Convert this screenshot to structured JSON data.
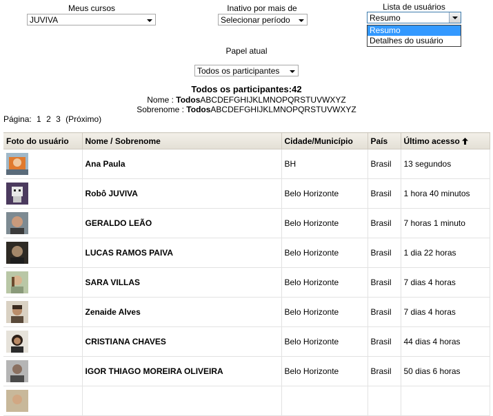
{
  "filters": {
    "courses": {
      "label": "Meus cursos",
      "value": "JUVIVA"
    },
    "inactive": {
      "label": "Inativo por mais de",
      "value": "Selecionar período"
    },
    "list": {
      "label": "Lista de usuários",
      "value": "Resumo",
      "options": [
        "Resumo",
        "Detalhes do usuário"
      ]
    },
    "role": {
      "label": "Papel atual",
      "value": "Todos os participantes"
    }
  },
  "summary": {
    "title": "Todos os participantes:42",
    "name_label": "Nome :",
    "surname_label": "Sobrenome :",
    "all": "Todos",
    "letters": "ABCDEFGHIJKLMNOPQRSTUVWXYZ"
  },
  "pager": {
    "label": "Página:",
    "pages": [
      "1",
      "2",
      "3"
    ],
    "next": "(Próximo)"
  },
  "table": {
    "headers": [
      "Foto do usuário",
      "Nome / Sobrenome",
      "Cidade/Município",
      "País",
      "Último acesso"
    ],
    "rows": [
      {
        "name": "Ana Paula",
        "city": "BH",
        "country": "Brasil",
        "last": "13 segundos"
      },
      {
        "name": "Robô JUVIVA",
        "city": "Belo Horizonte",
        "country": "Brasil",
        "last": "1 hora 40 minutos"
      },
      {
        "name": "GERALDO LEÃO",
        "city": "Belo Horizonte",
        "country": "Brasil",
        "last": "7 horas 1 minuto"
      },
      {
        "name": "LUCAS RAMOS PAIVA",
        "city": "Belo Horizonte",
        "country": "Brasil",
        "last": "1 dia 22 horas"
      },
      {
        "name": "SARA VILLAS",
        "city": "Belo Horizonte",
        "country": "Brasil",
        "last": "7 dias 4 horas"
      },
      {
        "name": "Zenaide Alves",
        "city": "Belo Horizonte",
        "country": "Brasil",
        "last": "7 dias 4 horas"
      },
      {
        "name": "CRISTIANA CHAVES",
        "city": "Belo Horizonte",
        "country": "Brasil",
        "last": "44 dias 4 horas"
      },
      {
        "name": "IGOR THIAGO MOREIRA OLIVEIRA",
        "city": "Belo Horizonte",
        "country": "Brasil",
        "last": "50 dias 6 horas"
      },
      {
        "name": "",
        "city": "",
        "country": "",
        "last": ""
      }
    ]
  }
}
